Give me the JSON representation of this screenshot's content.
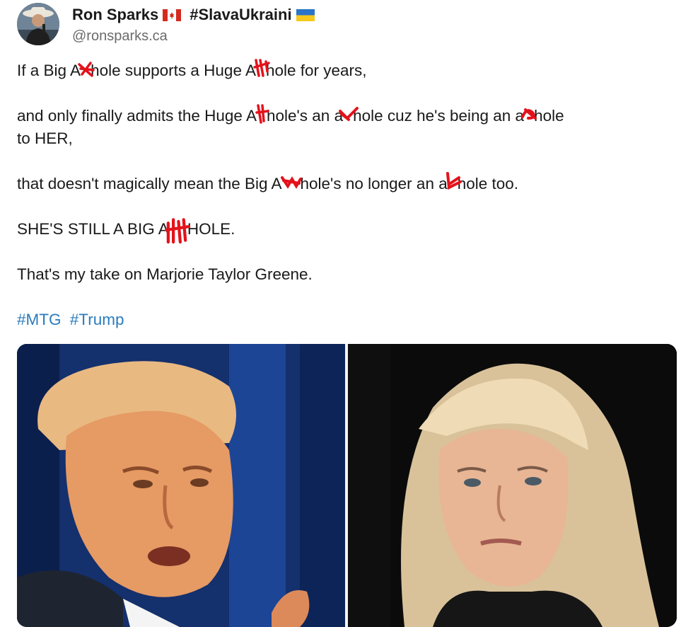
{
  "author": {
    "display_name": "Ron Sparks",
    "hashtag_title": "#SlavaUkraini",
    "handle": "@ronsparks.ca"
  },
  "post": {
    "lines": [
      {
        "segments": [
          "If a Big A",
          "hole supports a Huge A",
          "hole for years,"
        ]
      },
      {
        "segments": [
          "and only finally admits the Huge A",
          "hole's an a",
          "hole cuz he's being an a",
          "hole",
          "to HER,"
        ]
      },
      {
        "segments": [
          "that doesn't magically mean the Big A",
          "hole's no longer an a",
          "hole too."
        ]
      },
      {
        "segments": [
          "SHE'S STILL A BIG A",
          "HOLE."
        ]
      },
      {
        "segments": [
          "That's my take on Marjorie Taylor Greene."
        ]
      }
    ],
    "hashtags": [
      "#MTG",
      "#Trump"
    ]
  },
  "colors": {
    "hashtag": "#2c7bbd",
    "censor_mark": "#e3121b"
  },
  "media": {
    "left_photo": "photo of Donald Trump",
    "right_photo": "photo of Marjorie Taylor Greene"
  }
}
